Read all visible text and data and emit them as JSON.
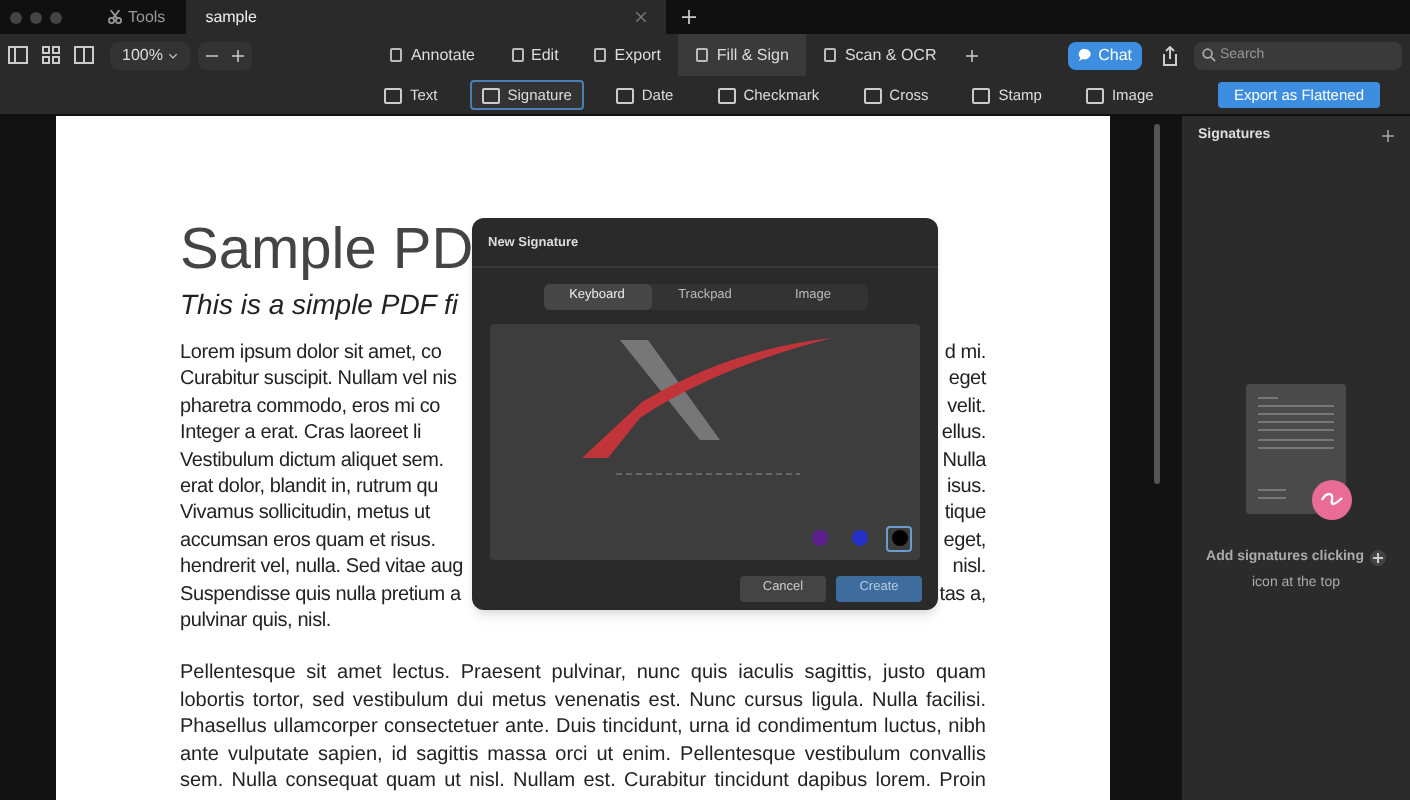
{
  "window": {
    "tabs": [
      {
        "label": "Tools",
        "selected": false
      },
      {
        "label": "sample",
        "selected": true
      }
    ]
  },
  "toolbar": {
    "zoom": "100%",
    "modes": [
      {
        "label": "Annotate",
        "selected": false
      },
      {
        "label": "Edit",
        "selected": false
      },
      {
        "label": "Export",
        "selected": false
      },
      {
        "label": "Fill & Sign",
        "selected": true
      },
      {
        "label": "Scan & OCR",
        "selected": false
      }
    ],
    "chat": "Chat",
    "search": {
      "placeholder": "Search"
    }
  },
  "tools": {
    "items": [
      {
        "label": "Text",
        "selected": false
      },
      {
        "label": "Signature",
        "selected": true
      },
      {
        "label": "Date",
        "selected": false
      },
      {
        "label": "Checkmark",
        "selected": false
      },
      {
        "label": "Cross",
        "selected": false
      },
      {
        "label": "Stamp",
        "selected": false
      },
      {
        "label": "Image",
        "selected": false
      }
    ],
    "export": "Export as Flattened"
  },
  "document": {
    "title": "Sample PD",
    "subtitle": "This is a simple PDF fi",
    "paragraph_1": [
      {
        "left": "Lorem ipsum dolor sit amet, co",
        "right": "d mi."
      },
      {
        "left": "Curabitur suscipit. Nullam vel nis",
        "right": "eget"
      },
      {
        "left": "pharetra commodo, eros mi co",
        "right": "velit."
      },
      {
        "left": "Integer a erat. Cras laoreet li",
        "right": "ellus."
      },
      {
        "left": "Vestibulum dictum aliquet sem.",
        "right": "Nulla"
      },
      {
        "left": "erat dolor, blandit in, rutrum qu",
        "right": "isus."
      },
      {
        "left": "Vivamus sollicitudin, metus ut",
        "right": "tique"
      },
      {
        "left": "accumsan eros quam et risus.",
        "right": "eget,"
      },
      {
        "left": "hendrerit vel, nulla. Sed vitae aug",
        "right": "nisl."
      },
      {
        "left": "Suspendisse quis nulla pretium a",
        "right": "tas a,"
      },
      {
        "left": "pulvinar quis, nisl."
      }
    ],
    "paragraph_2": [
      "Pellentesque sit amet lectus. Praesent pulvinar, nunc quis iaculis sagittis, justo quam",
      "lobortis tortor, sed vestibulum dui metus venenatis est. Nunc cursus ligula. Nulla facilisi.",
      "Phasellus ullamcorper consectetuer ante. Duis tincidunt, urna id condimentum luctus, nibh",
      "ante vulputate sapien, id sagittis massa orci ut enim. Pellentesque vestibulum convallis",
      "sem. Nulla consequat quam ut nisl. Nullam est. Curabitur tincidunt dapibus lorem. Proin"
    ]
  },
  "dialog": {
    "title": "New Signature",
    "tabs": [
      {
        "label": "Keyboard",
        "selected": true
      },
      {
        "label": "Trackpad",
        "selected": false
      },
      {
        "label": "Image",
        "selected": false
      }
    ],
    "colors": [
      {
        "color": "#5b1e8c",
        "selected": false
      },
      {
        "color": "#2531c4",
        "selected": false
      },
      {
        "color": "#000000",
        "selected": true
      }
    ],
    "buttons": [
      {
        "label": "Cancel",
        "kind": "secondary"
      },
      {
        "label": "Create",
        "kind": "primary"
      }
    ]
  },
  "sidebar": {
    "title": "Signatures",
    "hint_1": "Add signatures clicking",
    "hint_2": "icon at the top"
  }
}
